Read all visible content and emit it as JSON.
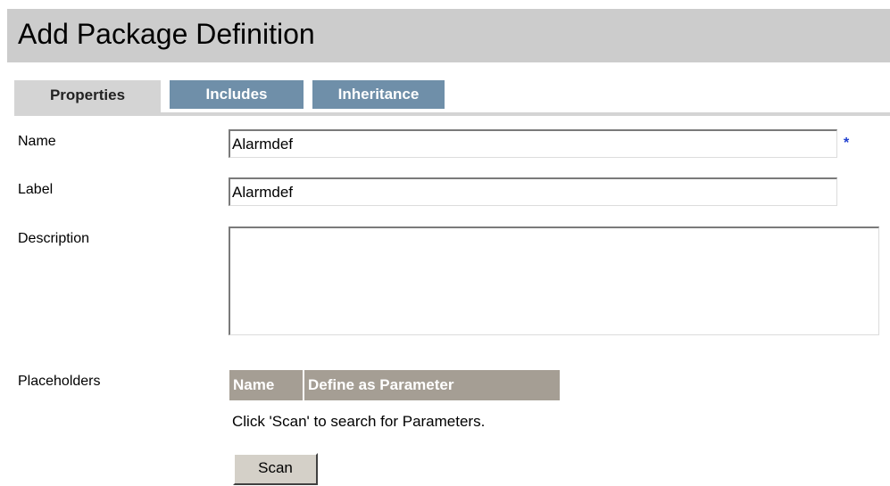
{
  "page": {
    "title": "Add Package Definition"
  },
  "tabs": [
    {
      "label": "Properties",
      "active": true
    },
    {
      "label": "Includes",
      "active": false
    },
    {
      "label": "Inheritance",
      "active": false
    }
  ],
  "form": {
    "name": {
      "label": "Name",
      "value": "Alarmdef",
      "required_marker": "*"
    },
    "label": {
      "label": "Label",
      "value": "Alarmdef"
    },
    "description": {
      "label": "Description",
      "value": ""
    },
    "placeholders": {
      "label": "Placeholders",
      "columns": [
        "Name",
        "Define as Parameter"
      ],
      "hint": "Click 'Scan' to search for Parameters.",
      "scan_label": "Scan"
    }
  },
  "colors": {
    "title_bar": "#cccccc",
    "tab_active": "#d4d4d4",
    "tab_inactive": "#6f8fa9",
    "table_header": "#a59e94",
    "required": "#1f3fd0"
  }
}
